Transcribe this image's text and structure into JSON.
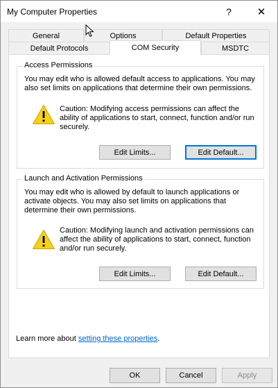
{
  "window": {
    "title": "My Computer Properties",
    "help_glyph": "?",
    "close_glyph": "✕"
  },
  "tabs": {
    "row1": [
      "General",
      "Options",
      "Default Properties"
    ],
    "row2": [
      "Default Protocols",
      "COM Security",
      "MSDTC"
    ],
    "active": "COM Security"
  },
  "access": {
    "title": "Access Permissions",
    "description": "You may edit who is allowed default access to applications. You may also set limits on applications that determine their own permissions.",
    "caution": "Caution: Modifying access permissions can affect the ability of applications to start, connect, function and/or run securely.",
    "edit_limits": "Edit Limits...",
    "edit_default": "Edit Default..."
  },
  "launch": {
    "title": "Launch and Activation Permissions",
    "description": "You may edit who is allowed by default to launch applications or activate objects. You may also set limits on applications that determine their own permissions.",
    "caution": "Caution: Modifying launch and activation permissions can affect the ability of applications to start, connect, function and/or run securely.",
    "edit_limits": "Edit Limits...",
    "edit_default": "Edit Default..."
  },
  "footer": {
    "learn_prefix": "Learn more about",
    "learn_link": "setting these properties",
    "learn_suffix": "."
  },
  "buttons": {
    "ok": "OK",
    "cancel": "Cancel",
    "apply": "Apply"
  },
  "colors": {
    "accent": "#0078d7",
    "link": "#0066cc",
    "warning_yellow": "#f7d117"
  },
  "icons": [
    "help-icon",
    "close-icon",
    "warning-icon",
    "mouse-cursor-icon"
  ]
}
